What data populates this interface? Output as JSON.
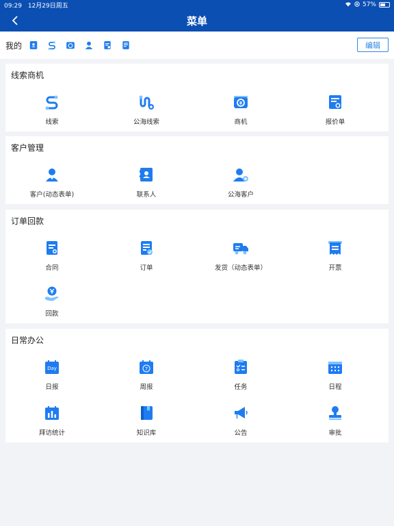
{
  "status": {
    "time": "09:29",
    "date": "12月29日周五",
    "battery": "57%"
  },
  "nav": {
    "title": "菜单"
  },
  "mine": {
    "label": "我的",
    "edit_label": "编辑"
  },
  "colors": {
    "brand": "#0b4fb3",
    "icon_blue": "#1f7cf0",
    "accent": "#2f86e6"
  },
  "sections": {
    "leads": {
      "title": "线索商机",
      "items": [
        {
          "label": "线索",
          "icon": "lead-icon"
        },
        {
          "label": "公海线索",
          "icon": "public-lead-icon"
        },
        {
          "label": "商机",
          "icon": "opportunity-icon"
        },
        {
          "label": "报价单",
          "icon": "quote-icon"
        }
      ]
    },
    "customers": {
      "title": "客户管理",
      "items": [
        {
          "label": "客户(动态表单)",
          "icon": "customer-icon"
        },
        {
          "label": "联系人",
          "icon": "contact-icon"
        },
        {
          "label": "公海客户",
          "icon": "public-customer-icon"
        }
      ]
    },
    "orders": {
      "title": "订单回款",
      "items": [
        {
          "label": "合同",
          "icon": "contract-icon"
        },
        {
          "label": "订单",
          "icon": "order-icon"
        },
        {
          "label": "发货（动态表单）",
          "icon": "delivery-truck-icon"
        },
        {
          "label": "开票",
          "icon": "invoice-icon"
        },
        {
          "label": "回款",
          "icon": "payment-icon"
        }
      ]
    },
    "office": {
      "title": "日常办公",
      "items": [
        {
          "label": "日报",
          "icon": "daily-report-icon",
          "badge": "Day"
        },
        {
          "label": "周报",
          "icon": "weekly-report-icon",
          "badge": "7"
        },
        {
          "label": "任务",
          "icon": "task-icon"
        },
        {
          "label": "日程",
          "icon": "schedule-icon"
        },
        {
          "label": "拜访统计",
          "icon": "visit-stats-icon"
        },
        {
          "label": "知识库",
          "icon": "knowledge-base-icon"
        },
        {
          "label": "公告",
          "icon": "announcement-icon"
        },
        {
          "label": "审批",
          "icon": "approval-icon"
        }
      ]
    }
  }
}
